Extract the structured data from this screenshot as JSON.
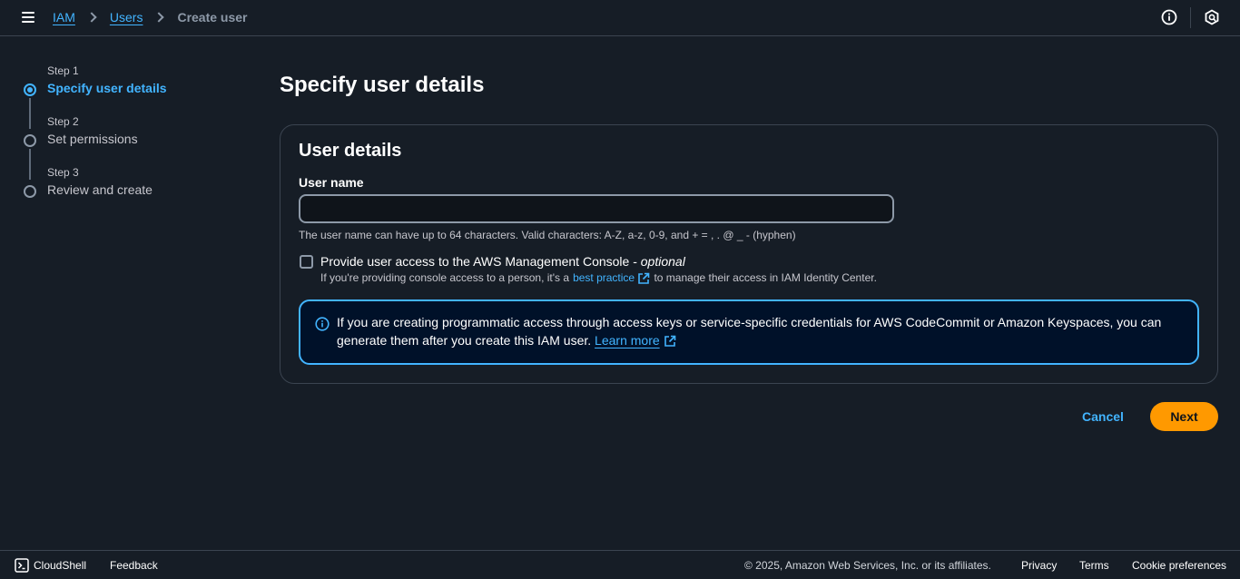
{
  "breadcrumb": {
    "items": [
      "IAM",
      "Users"
    ],
    "current": "Create user"
  },
  "steps": [
    {
      "num": "Step 1",
      "title": "Specify user details",
      "active": true
    },
    {
      "num": "Step 2",
      "title": "Set permissions",
      "active": false
    },
    {
      "num": "Step 3",
      "title": "Review and create",
      "active": false
    }
  ],
  "page": {
    "title": "Specify user details"
  },
  "user_details": {
    "heading": "User details",
    "username_label": "User name",
    "username_value": "",
    "username_hint": "The user name can have up to 64 characters. Valid characters: A-Z, a-z, 0-9, and + = , . @ _ - (hyphen)",
    "console_checkbox_label": "Provide user access to the AWS Management Console - ",
    "console_checkbox_optional": "optional",
    "console_checkbox_checked": false,
    "console_desc_before": "If you're providing console access to a person, it's a",
    "console_desc_link": "best practice",
    "console_desc_after": "to manage their access in IAM Identity Center."
  },
  "alert": {
    "text": "If you are creating programmatic access through access keys or service-specific credentials for AWS CodeCommit or Amazon Keyspaces, you can generate them after you create this IAM user.",
    "link": "Learn more"
  },
  "actions": {
    "cancel": "Cancel",
    "next": "Next"
  },
  "footer": {
    "cloudshell": "CloudShell",
    "feedback": "Feedback",
    "copyright": "© 2025, Amazon Web Services, Inc. or its affiliates.",
    "privacy": "Privacy",
    "terms": "Terms",
    "cookie": "Cookie preferences"
  },
  "colors": {
    "background": "#161d26",
    "link": "#42b4ff",
    "primary_button": "#ff9900"
  },
  "icons": [
    "menu-icon",
    "info-circle-icon",
    "notification-icon",
    "external-link-icon",
    "cloudshell-icon"
  ]
}
